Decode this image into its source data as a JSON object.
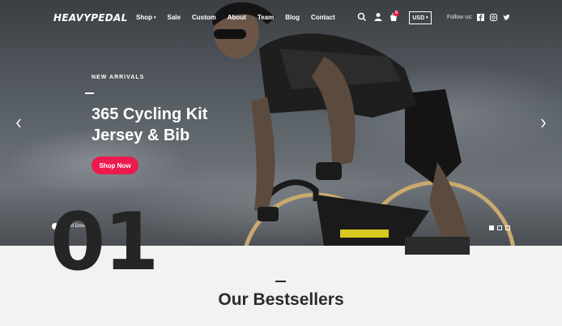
{
  "brand": {
    "logo_text": "HEAVYPEDAL"
  },
  "nav": {
    "items": [
      {
        "label": "Shop",
        "has_caret": true
      },
      {
        "label": "Sale"
      },
      {
        "label": "Custom"
      },
      {
        "label": "About"
      },
      {
        "label": "Team"
      },
      {
        "label": "Blog"
      },
      {
        "label": "Contact"
      }
    ],
    "caret_symbol": "▾"
  },
  "header": {
    "icons": [
      "search-icon",
      "user-icon",
      "cart-icon"
    ],
    "cart_count": "0",
    "currency": "USD",
    "currency_caret": "▾",
    "follow_label": "Follow us:",
    "social": [
      "facebook-icon",
      "instagram-icon",
      "twitter-icon"
    ]
  },
  "hero": {
    "eyebrow": "NEW ARRIVALS",
    "title_line1": "365 Cycling Kit",
    "title_line2": "Jersey & Bib",
    "cta": "Shop Now",
    "scroll_label": "Scroll Down",
    "slides_total": 3,
    "active_slide": 1
  },
  "section": {
    "number": "01",
    "title": "Our Bestsellers"
  },
  "colors": {
    "accent": "#ec1a4f",
    "dark": "#2b2b2b",
    "background": "#f2f2f0"
  }
}
